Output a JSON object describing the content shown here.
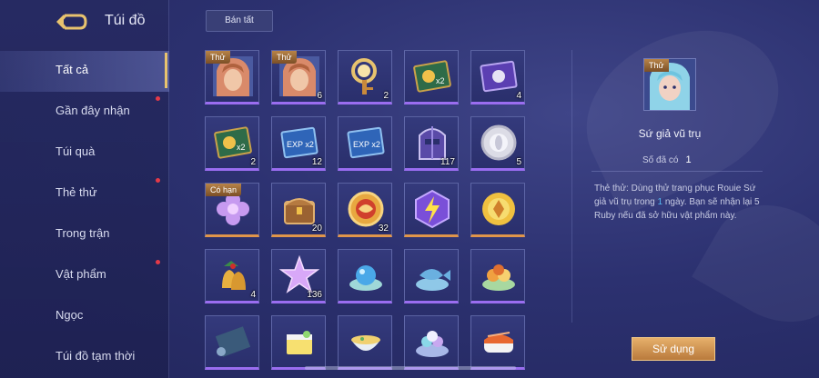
{
  "header": {
    "title": "Túi đồ",
    "sell_all": "Bán tất"
  },
  "nav": [
    {
      "label": "Tất cả",
      "active": true,
      "dot": false
    },
    {
      "label": "Gần đây nhận",
      "active": false,
      "dot": true
    },
    {
      "label": "Túi quà",
      "active": false,
      "dot": false
    },
    {
      "label": "Thẻ thử",
      "active": false,
      "dot": true
    },
    {
      "label": "Trong trận",
      "active": false,
      "dot": false
    },
    {
      "label": "Vật phẩm",
      "active": false,
      "dot": true
    },
    {
      "label": "Ngọc",
      "active": false,
      "dot": false
    },
    {
      "label": "Túi đồ tạm thời",
      "active": false,
      "dot": false
    }
  ],
  "items": [
    {
      "name": "trial-skin-rouie",
      "icon": "hero-portrait-icon",
      "tag": "Thử",
      "count": "",
      "bar": "purple"
    },
    {
      "name": "trial-skin-hero",
      "icon": "hero-portrait-icon",
      "tag": "Thử",
      "count": "6",
      "bar": "purple"
    },
    {
      "name": "magnifier-key",
      "icon": "magnifier-key-icon",
      "tag": "",
      "count": "2",
      "bar": "purple"
    },
    {
      "name": "gold-x2-card",
      "icon": "gold-x2-card-icon",
      "tag": "",
      "count": "",
      "bar": "purple"
    },
    {
      "name": "purple-ticket",
      "icon": "purple-ticket-icon",
      "tag": "",
      "count": "4",
      "bar": "purple"
    },
    {
      "name": "gold-x2-card-2",
      "icon": "gold-x2-card-icon",
      "tag": "",
      "count": "2",
      "bar": "purple"
    },
    {
      "name": "exp-x2-card",
      "icon": "exp-x2-card-icon",
      "tag": "",
      "count": "12",
      "bar": "purple"
    },
    {
      "name": "exp-x2-card-2",
      "icon": "exp-x2-card-icon",
      "tag": "",
      "count": "",
      "bar": "purple"
    },
    {
      "name": "helmet-token",
      "icon": "helmet-icon",
      "tag": "",
      "count": "117",
      "bar": "purple"
    },
    {
      "name": "silver-coin",
      "icon": "silver-coin-icon",
      "tag": "",
      "count": "5",
      "bar": "purple"
    },
    {
      "name": "limited-flower",
      "icon": "flower-icon",
      "tag": "Có hạn",
      "count": "",
      "bar": "orange"
    },
    {
      "name": "treasure-chest",
      "icon": "chest-icon",
      "tag": "",
      "count": "20",
      "bar": "orange"
    },
    {
      "name": "dragon-coin",
      "icon": "dragon-coin-icon",
      "tag": "",
      "count": "32",
      "bar": "orange"
    },
    {
      "name": "lightning-gem",
      "icon": "lightning-icon",
      "tag": "",
      "count": "",
      "bar": "orange"
    },
    {
      "name": "sun-emblem",
      "icon": "sun-emblem-icon",
      "tag": "",
      "count": "",
      "bar": "orange"
    },
    {
      "name": "christmas-bells",
      "icon": "bells-icon",
      "tag": "",
      "count": "4",
      "bar": "purple"
    },
    {
      "name": "crystal-star",
      "icon": "star-crystal-icon",
      "tag": "",
      "count": "136",
      "bar": "purple"
    },
    {
      "name": "blue-orb-dish",
      "icon": "orb-dish-icon",
      "tag": "",
      "count": "",
      "bar": "purple"
    },
    {
      "name": "fish-dish",
      "icon": "fish-dish-icon",
      "tag": "",
      "count": "",
      "bar": "purple"
    },
    {
      "name": "fruit-dish",
      "icon": "fruit-dish-icon",
      "tag": "",
      "count": "",
      "bar": "purple"
    },
    {
      "name": "scroll",
      "icon": "scroll-icon",
      "tag": "",
      "count": "",
      "bar": "purple"
    },
    {
      "name": "cake",
      "icon": "cake-icon",
      "tag": "",
      "count": "",
      "bar": "purple"
    },
    {
      "name": "soup-bowl",
      "icon": "soup-bowl-icon",
      "tag": "",
      "count": "",
      "bar": "purple"
    },
    {
      "name": "flower-dish",
      "icon": "flower-dish-icon",
      "tag": "",
      "count": "",
      "bar": "purple"
    },
    {
      "name": "sushi",
      "icon": "sushi-icon",
      "tag": "",
      "count": "",
      "bar": "purple"
    }
  ],
  "detail": {
    "tag": "Thử",
    "name": "Sứ giả vũ trụ",
    "owned_label": "Số đã có",
    "owned_value": "1",
    "desc_prefix": "Thẻ thử: Dùng thử trang phục Rouie Sứ giả vũ trụ trong ",
    "desc_days": "1",
    "desc_suffix": " ngày. Bạn sẽ nhận lại 5 Ruby nếu đã sở hữu vật phẩm này.",
    "use_button": "Sử dụng"
  },
  "colors": {
    "accent_gold": "#e8c36e",
    "bar_purple": "#9a6df0",
    "bar_orange": "#e0954a",
    "badge_red": "#e53a48",
    "link_blue": "#55b9f2"
  }
}
